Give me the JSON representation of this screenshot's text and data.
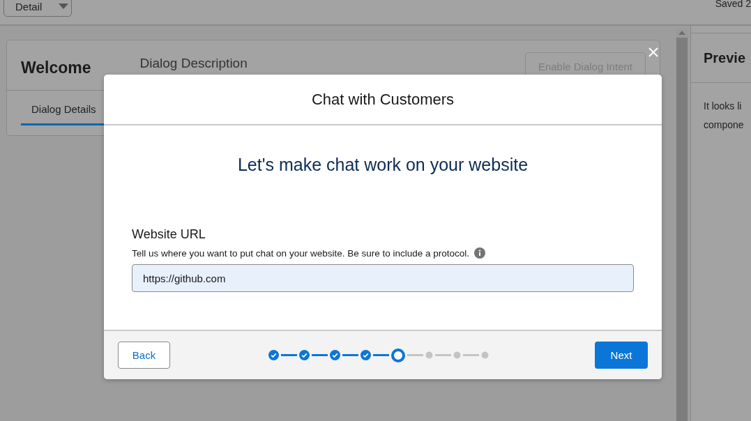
{
  "topbar": {
    "view_button": "Detail",
    "status": "Saved 2"
  },
  "dialog_card": {
    "title": "Welcome",
    "description_label": "Dialog Description",
    "intent_button": {
      "label": "Enable Dialog Intent",
      "disabled": true
    },
    "tabs": [
      {
        "label": "Dialog Details",
        "selected": true
      }
    ]
  },
  "preview": {
    "title": "Previe",
    "lines": [
      "It looks li",
      "compone"
    ]
  },
  "modal": {
    "title": "Chat with Customers",
    "heading": "Let's make chat work on your website",
    "field": {
      "label": "Website URL",
      "help": "Tell us where you want to put chat on your website. Be sure to include a protocol.",
      "value": "https://github.com"
    },
    "back_button": "Back",
    "next_button": "Next",
    "steps": [
      {
        "kind": "complete"
      },
      {
        "kind": "complete"
      },
      {
        "kind": "complete"
      },
      {
        "kind": "complete"
      },
      {
        "kind": "current"
      },
      {
        "kind": "upcoming"
      },
      {
        "kind": "upcoming"
      },
      {
        "kind": "upcoming"
      }
    ]
  }
}
